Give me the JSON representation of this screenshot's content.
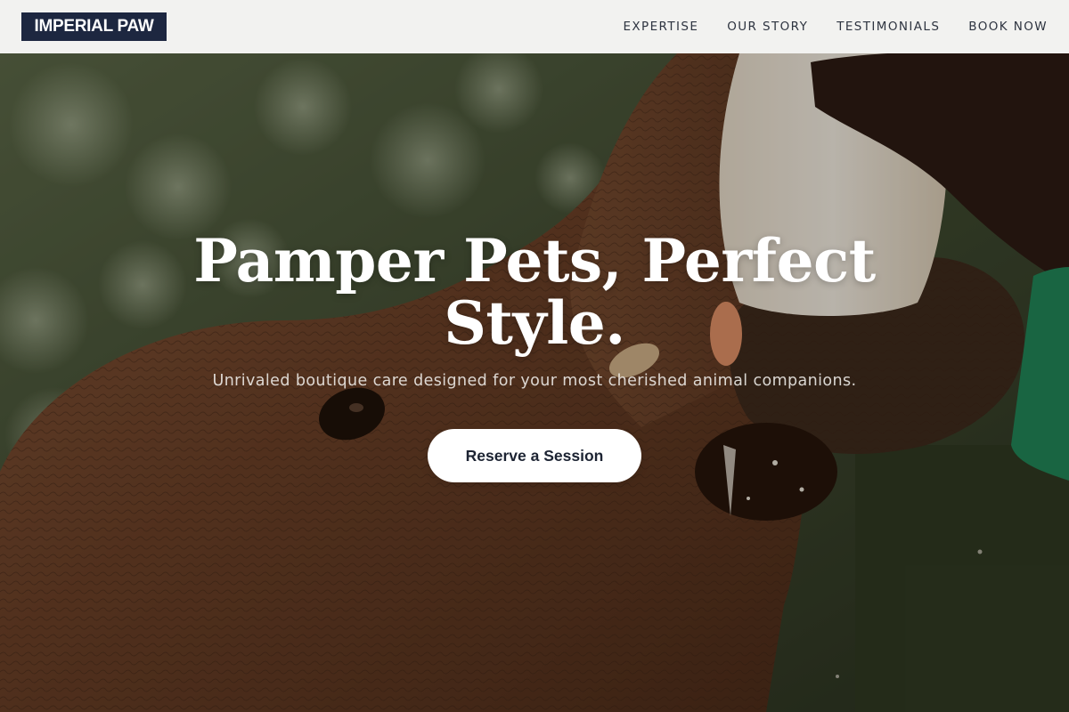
{
  "header": {
    "logo": "IMPERIAL PAW",
    "nav": [
      {
        "label": "EXPERTISE"
      },
      {
        "label": "OUR STORY"
      },
      {
        "label": "TESTIMONIALS"
      },
      {
        "label": "BOOK NOW"
      }
    ]
  },
  "hero": {
    "headline": "Pamper Pets, Perfect Style.",
    "subheadline": "Unrivaled boutique care designed for your most cherished animal companions.",
    "cta_label": "Reserve a Session",
    "image_subject": "elephant-calf-bottle-feeding-photo"
  },
  "colors": {
    "logo_bg": "#1d2740",
    "nav_text": "#2e3440",
    "header_bg": "#f8f8f7",
    "cta_bg": "#ffffff",
    "cta_text": "#1d2433"
  }
}
